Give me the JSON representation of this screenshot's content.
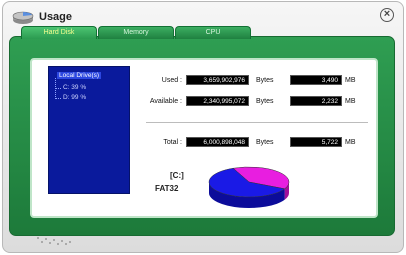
{
  "window": {
    "title": "Usage"
  },
  "tabs": [
    {
      "label": "Hard Disk",
      "active": true
    },
    {
      "label": "Memory",
      "active": false
    },
    {
      "label": "CPU",
      "active": false
    }
  ],
  "tree": {
    "root": "Local Drive(s)",
    "items": [
      "C:  39 %",
      "D:  99 %"
    ]
  },
  "stats": {
    "used": {
      "label": "Used :",
      "bytes": "3,659,902,976",
      "bytes_unit": "Bytes",
      "mb": "3,490",
      "mb_unit": "MB"
    },
    "available": {
      "label": "Available :",
      "bytes": "2,340,995,072",
      "bytes_unit": "Bytes",
      "mb": "2,232",
      "mb_unit": "MB"
    },
    "total": {
      "label": "Total :",
      "bytes": "6,000,898,048",
      "bytes_unit": "Bytes",
      "mb": "5,722",
      "mb_unit": "MB"
    }
  },
  "drive": {
    "letter": "[C:]",
    "filesystem": "FAT32"
  },
  "pie": {
    "used_fraction": 0.61,
    "used_color": "#1a1ae6",
    "available_color": "#e81ee0"
  },
  "colors": {
    "panel": "#2a8f4a",
    "tree_bg": "#0a1a9c",
    "active_tab_text": "#f6ff8f"
  }
}
